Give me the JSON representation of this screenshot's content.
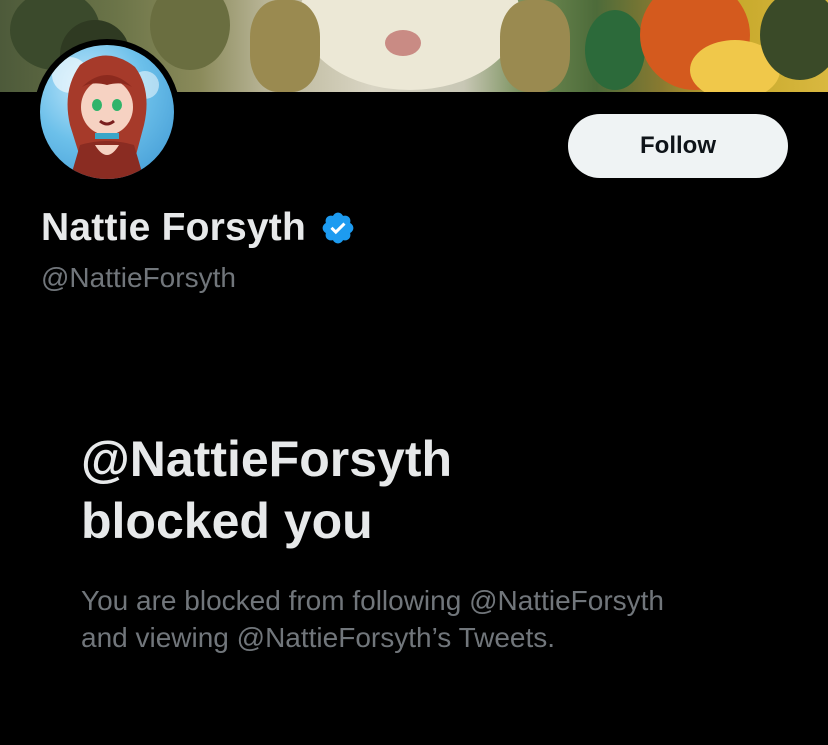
{
  "profile": {
    "display_name": "Nattie Forsyth",
    "handle": "@NattieForsyth",
    "verified": true,
    "verified_color": "#1d9bf0"
  },
  "actions": {
    "follow_label": "Follow"
  },
  "blocked": {
    "title_line1": "@NattieForsyth",
    "title_line2": "blocked you",
    "desc_line1": "You are blocked from following @NattieForsyth",
    "desc_line2": "and viewing @NattieForsyth’s Tweets."
  },
  "colors": {
    "background": "#000000",
    "primary_text": "#e7e9ea",
    "secondary_text": "#71767b",
    "button_bg": "#eff3f4",
    "button_text": "#0f1419"
  }
}
